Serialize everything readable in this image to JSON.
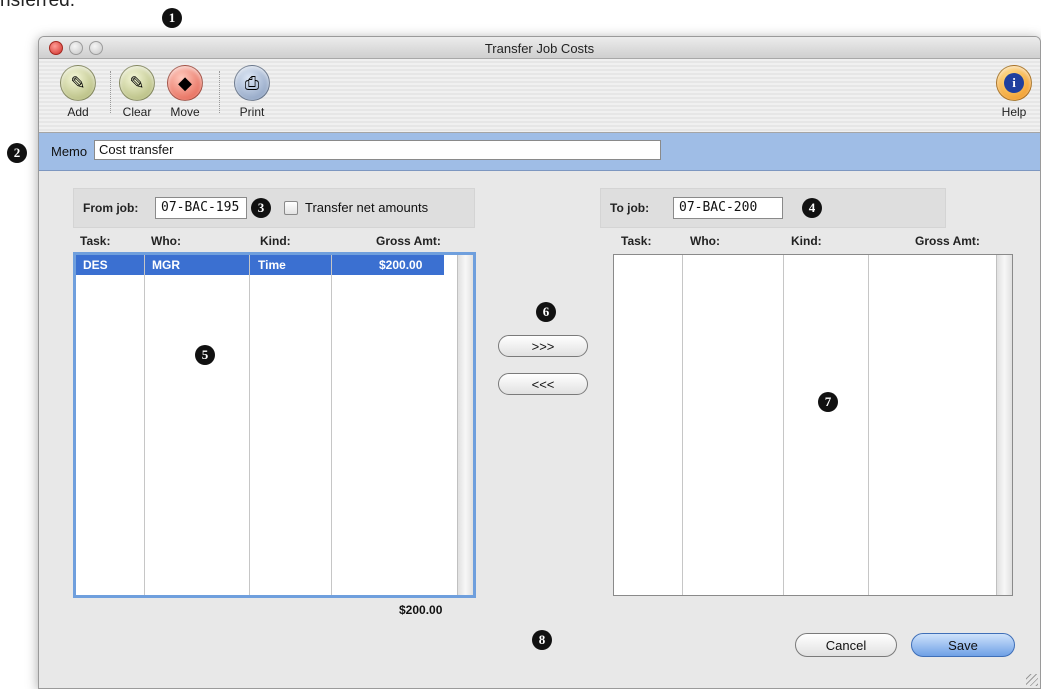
{
  "caption": {
    "text": "nsferred."
  },
  "callouts": [
    "1",
    "2",
    "3",
    "4",
    "5",
    "6",
    "7",
    "8"
  ],
  "window": {
    "title": "Transfer Job Costs"
  },
  "toolbar": {
    "add": {
      "label": "Add",
      "icon": "pencil-icon"
    },
    "clear": {
      "label": "Clear",
      "icon": "pencil-icon"
    },
    "move": {
      "label": "Move",
      "icon": "eraser-icon"
    },
    "print": {
      "label": "Print",
      "icon": "printer-icon"
    },
    "help": {
      "label": "Help",
      "icon": "info-icon",
      "glyph": "i"
    }
  },
  "memo": {
    "label": "Memo",
    "value": "Cost transfer"
  },
  "from": {
    "label": "From job:",
    "job": "07-BAC-195",
    "transfer_net_label": "Transfer net amounts",
    "transfer_net_checked": false,
    "columns": [
      "Task:",
      "Who:",
      "Kind:",
      "Gross Amt:"
    ],
    "rows": [
      {
        "task": "DES",
        "who": "MGR",
        "kind": "Time",
        "gross": "$200.00",
        "selected": true
      }
    ],
    "total": "$200.00"
  },
  "to": {
    "label": "To job:",
    "job": "07-BAC-200",
    "columns": [
      "Task:",
      "Who:",
      "Kind:",
      "Gross Amt:"
    ],
    "rows": []
  },
  "transfer_buttons": {
    "forward": ">>>",
    "back": "<<<"
  },
  "actions": {
    "cancel": "Cancel",
    "save": "Save"
  },
  "colors": {
    "memo_bar": "#9fbde6",
    "selection": "#3b70d1",
    "default_button": "#6fa0e6"
  }
}
